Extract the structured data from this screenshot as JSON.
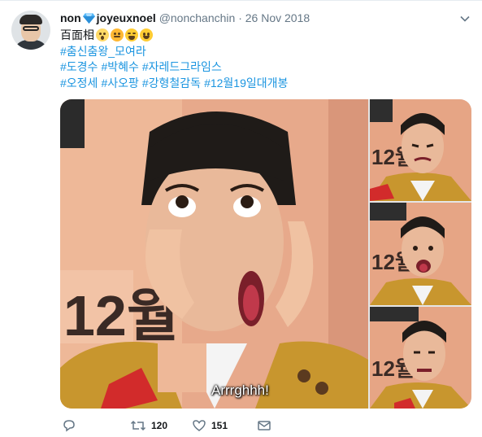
{
  "tweet": {
    "display_name": "non",
    "display_name_suffix": "joyeuxnoel",
    "handle": "@nonchanchin",
    "separator": "·",
    "date": "26 Nov 2018",
    "text_prefix": "百面相",
    "emojis": [
      "scream-emoji",
      "steam-emoji",
      "tired-emoji",
      "grin-emoji"
    ],
    "hashtag_lines": [
      [
        "#춤신춤왕_모여라"
      ],
      [
        "#도경수",
        "#박혜수",
        "#자레드그라임스"
      ],
      [
        "#오정세",
        "#사오팡",
        "#강형철감독",
        "#12월19일대개봉"
      ]
    ],
    "image_caption": "Arrrghhh!",
    "stats": {
      "replies": "",
      "retweets": "120",
      "likes": "151"
    }
  },
  "colors": {
    "link": "#1b95e0",
    "muted": "#657786",
    "text": "#14171a",
    "jacket": "#c8962e",
    "backdrop": "#e9a98a"
  },
  "icons": {
    "verified_like": "blue-diamond-icon",
    "menu": "chevron-down-icon",
    "reply": "reply-icon",
    "retweet": "retweet-icon",
    "like": "heart-icon",
    "dm": "envelope-icon"
  }
}
